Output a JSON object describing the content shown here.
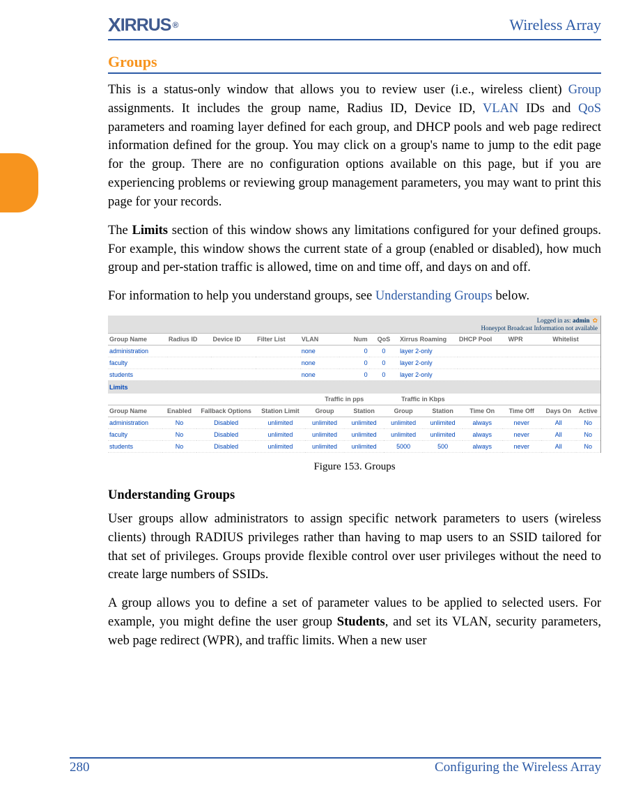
{
  "header": {
    "brand_prefix": "X",
    "brand_i1": "I",
    "brand_rest": "RRUS",
    "brand_reg": "®",
    "title": "Wireless Array"
  },
  "section": {
    "title": "Groups"
  },
  "para1": {
    "t1": "This is a status-only window that allows you to review user (i.e., wireless client) ",
    "link1": "Group",
    "t2": " assignments. It includes the group name, Radius ID, Device ID, ",
    "link2": "VLAN",
    "t3": " IDs and ",
    "link3": "QoS",
    "t4": " parameters and roaming layer defined for each group, and DHCP pools and web page redirect information defined for the group. You may click on a group's name to jump to the edit page for the group. There are no configuration options available on this page, but if you are experiencing problems or reviewing group management parameters, you may want to print this page for your records."
  },
  "para2": {
    "t1": "The ",
    "b1": "Limits",
    "t2": " section of this window shows any limitations configured for your defined groups. For example, this window shows the current state of a group (enabled or disabled), how much group and per-station traffic is allowed, time on and time off, and days on and off."
  },
  "para3": {
    "t1": "For information to help you understand groups, see ",
    "link1": "Understanding Groups",
    "t2": " below."
  },
  "figure_caption": "Figure 153. Groups",
  "fig": {
    "logged_in_label": "Logged in as: ",
    "logged_in_user": "admin",
    "gear": "✿",
    "sub": "Honeypot Broadcast Information not available",
    "limits_label": "Limits",
    "t1_headers": [
      "Group Name",
      "Radius ID",
      "Device ID",
      "Filter List",
      "VLAN",
      "Num",
      "QoS",
      "Xirrus Roaming",
      "DHCP Pool",
      "WPR",
      "Whitelist"
    ],
    "t1_rows": [
      {
        "name": "administration",
        "radius": "",
        "device": "",
        "filter": "",
        "vlan": "none",
        "num": "0",
        "qos": "0",
        "roaming": "layer 2-only",
        "dhcp": "",
        "wpr": "",
        "white": ""
      },
      {
        "name": "faculty",
        "radius": "",
        "device": "",
        "filter": "",
        "vlan": "none",
        "num": "0",
        "qos": "0",
        "roaming": "layer 2-only",
        "dhcp": "",
        "wpr": "",
        "white": ""
      },
      {
        "name": "students",
        "radius": "",
        "device": "",
        "filter": "",
        "vlan": "none",
        "num": "0",
        "qos": "0",
        "roaming": "layer 2-only",
        "dhcp": "",
        "wpr": "",
        "white": ""
      }
    ],
    "t2_group1": "Traffic in pps",
    "t2_group2": "Traffic in Kbps",
    "t2_headers": [
      "Group Name",
      "Enabled",
      "Fallback Options",
      "Station Limit",
      "Group",
      "Station",
      "Group",
      "Station",
      "Time On",
      "Time Off",
      "Days On",
      "Active"
    ],
    "t2_rows": [
      {
        "name": "administration",
        "enabled": "No",
        "fallback": "Disabled",
        "slimit": "unlimited",
        "g1": "unlimited",
        "s1": "unlimited",
        "g2": "unlimited",
        "s2": "unlimited",
        "ton": "always",
        "toff": "never",
        "days": "All",
        "active": "No"
      },
      {
        "name": "faculty",
        "enabled": "No",
        "fallback": "Disabled",
        "slimit": "unlimited",
        "g1": "unlimited",
        "s1": "unlimited",
        "g2": "unlimited",
        "s2": "unlimited",
        "ton": "always",
        "toff": "never",
        "days": "All",
        "active": "No"
      },
      {
        "name": "students",
        "enabled": "No",
        "fallback": "Disabled",
        "slimit": "unlimited",
        "g1": "unlimited",
        "s1": "unlimited",
        "g2": "5000",
        "s2": "500",
        "ton": "always",
        "toff": "never",
        "days": "All",
        "active": "No"
      }
    ]
  },
  "subhead": "Understanding Groups",
  "para4": "User groups allow administrators to assign specific network parameters to users (wireless clients) through RADIUS privileges rather than having to map users to an SSID tailored for that set of privileges. Groups provide flexible control over user privileges without the need to create large numbers of SSIDs.",
  "para5": {
    "t1": "A group allows you to define a set of parameter values to be applied to selected users. For example, you might define the user group ",
    "b1": "Students",
    "t2": ", and set its VLAN, security parameters, web page redirect (WPR), and traffic limits. When a new user"
  },
  "footer": {
    "page": "280",
    "label": "Configuring the Wireless Array"
  }
}
